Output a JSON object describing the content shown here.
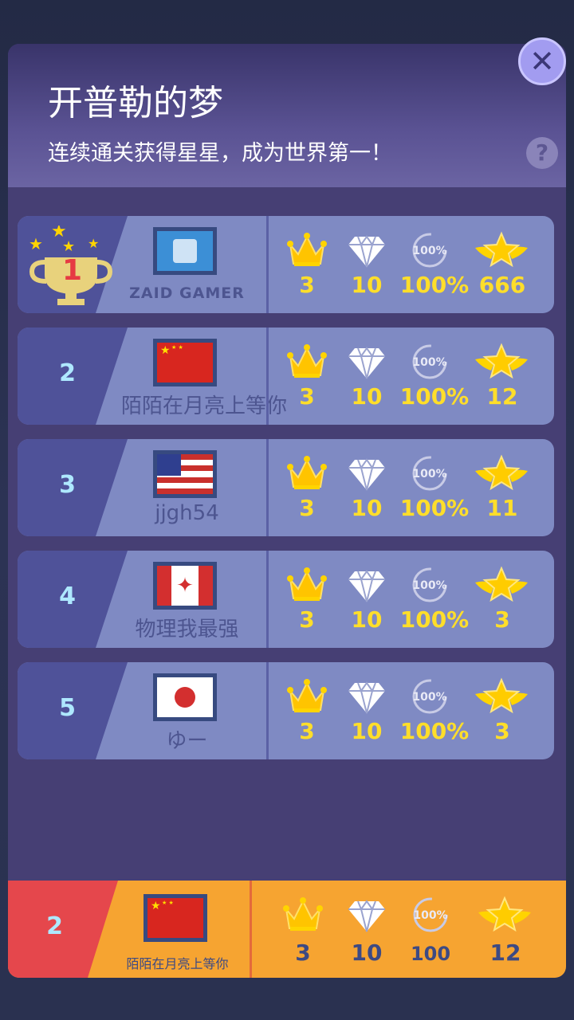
{
  "header": {
    "title": "开普勒的梦",
    "subtitle": "连续通关获得星星，成为世界第一！",
    "help_label": "?",
    "close_label": "✕"
  },
  "rows": [
    {
      "rank": "1",
      "name": "ZAID GAMER",
      "flag": "avatar",
      "crowns": "3",
      "diamonds": "10",
      "percent": "100%",
      "stars": "666"
    },
    {
      "rank": "2",
      "name": "陌陌在月亮上等你",
      "flag": "china",
      "crowns": "3",
      "diamonds": "10",
      "percent": "100%",
      "stars": "12"
    },
    {
      "rank": "3",
      "name": "jjgh54",
      "flag": "usa",
      "crowns": "3",
      "diamonds": "10",
      "percent": "100%",
      "stars": "11"
    },
    {
      "rank": "4",
      "name": "物理我最强",
      "flag": "canada",
      "crowns": "3",
      "diamonds": "10",
      "percent": "100%",
      "stars": "3"
    },
    {
      "rank": "5",
      "name": "ゆー",
      "flag": "japan",
      "crowns": "3",
      "diamonds": "10",
      "percent": "100%",
      "stars": "3"
    }
  ],
  "footer": {
    "rank": "2",
    "name": "陌陌在月亮上等你",
    "flag": "china",
    "crowns": "3",
    "diamonds": "10",
    "percent": "100",
    "stars": "12"
  },
  "icons": {
    "crown": "crown-icon",
    "diamond": "diamond-icon",
    "percent": "percent-100-icon",
    "star": "winged-star-icon"
  },
  "colors": {
    "gold": "#ffde2a",
    "rank_text": "#aee8ff",
    "first_place": "#e63a43",
    "footer": "#f6a431"
  }
}
